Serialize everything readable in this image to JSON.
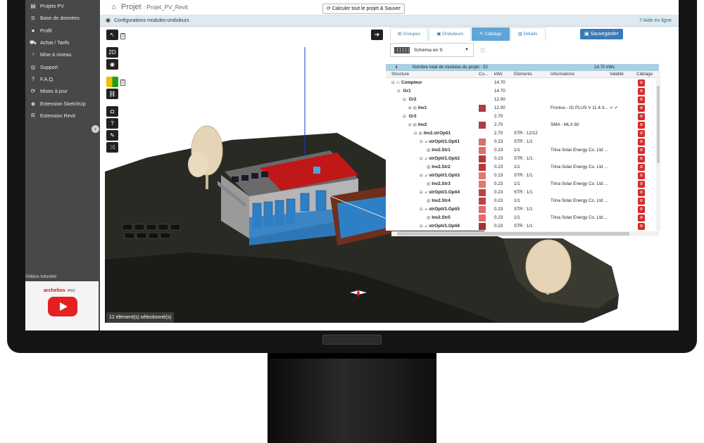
{
  "sidebar": {
    "items": [
      {
        "icon": "folder-icon",
        "glyph": "▤",
        "label": "Projets PV"
      },
      {
        "icon": "database-icon",
        "glyph": "≣",
        "label": "Base de données"
      },
      {
        "icon": "user-icon",
        "glyph": "●",
        "label": "Profil"
      },
      {
        "icon": "cart-icon",
        "glyph": "⛟",
        "label": "Achat / Tarifs"
      },
      {
        "icon": "upgrade-arrow-icon",
        "glyph": "↑",
        "label": "Mise à niveau"
      },
      {
        "icon": "support-icon",
        "glyph": "◎",
        "label": "Support"
      },
      {
        "icon": "question-icon",
        "glyph": "?",
        "label": "F.A.Q."
      },
      {
        "icon": "refresh-icon",
        "glyph": "⟳",
        "label": "Mises à jour"
      },
      {
        "icon": "sketchup-icon",
        "glyph": "◈",
        "label": "Extension SketchUp"
      },
      {
        "icon": "revit-icon",
        "glyph": "R",
        "label": "Extension Revit"
      }
    ],
    "tutorial_label": "Vidéos tutoriels",
    "tutorial_brand": "archelios",
    "tutorial_brand_suffix": "PRO"
  },
  "header": {
    "title": "Projet",
    "project_name": ": Projet_PV_Revit",
    "calc_button": "Calculer tout le projet & Sauver"
  },
  "subbar": {
    "title": "Configurations modules-onduleurs",
    "help": "Aide en ligne"
  },
  "viewport": {
    "tools_2d": "2D",
    "selection_status": "12 élément(s) sélectionné(s)"
  },
  "panel": {
    "tabs": [
      {
        "label": "Groupes",
        "glyph": "⊞"
      },
      {
        "label": "Onduleurs",
        "glyph": "▣"
      },
      {
        "label": "Câblage",
        "glyph": "✎"
      },
      {
        "label": "Détails",
        "glyph": "▥"
      }
    ],
    "active_tab": "Câblage",
    "save_button": "Sauvegarder",
    "schema_select": "Schéma en S",
    "summary_label": "Nombre total de modules du projet : 52",
    "summary_value": "14.70 kWc",
    "columns": {
      "structure": "Structure",
      "color": "Co...",
      "kwc": "kWc",
      "elements": "Eléments",
      "informations": "Informations",
      "validity": "Validité",
      "cabling": "Câblage"
    },
    "rows": [
      {
        "indent": 1,
        "pm": "⊟",
        "icon": "▭",
        "name": "Compteur",
        "bold": true,
        "color": "",
        "kwc": "14.70",
        "elements": "",
        "info": "",
        "valid": ""
      },
      {
        "indent": 2,
        "pm": "⊟",
        "icon": "",
        "name": "Gr1",
        "bold": true,
        "color": "",
        "kwc": "14.70",
        "elements": "",
        "info": "",
        "valid": ""
      },
      {
        "indent": 3,
        "pm": "⊟",
        "icon": "",
        "name": "Gr2",
        "bold": true,
        "color": "",
        "kwc": "12.00",
        "elements": "",
        "info": "",
        "valid": ""
      },
      {
        "indent": 4,
        "pm": "⊞",
        "icon": "▨",
        "name": "Inv1",
        "bold": true,
        "color": "#b23a3a",
        "kwc": "12.00",
        "elements": "",
        "info": "Fronius - IG PLUS V 11.4-3...",
        "valid": "✔ ✔"
      },
      {
        "indent": 3,
        "pm": "⊟",
        "icon": "",
        "name": "Gr3",
        "bold": true,
        "color": "",
        "kwc": "2.70",
        "elements": "",
        "info": "",
        "valid": ""
      },
      {
        "indent": 4,
        "pm": "⊟",
        "icon": "▨",
        "name": "Inv2",
        "bold": true,
        "color": "#b23a3a",
        "kwc": "2.70",
        "elements": "",
        "info": "SMA - MLX 60",
        "valid": ""
      },
      {
        "indent": 5,
        "pm": "⊟",
        "icon": "▥",
        "name": "Inv2.strOpti1",
        "bold": true,
        "color": "",
        "kwc": "2.70",
        "elements": "STR : 12/12",
        "info": "",
        "valid": ""
      },
      {
        "indent": 6,
        "pm": "⊟",
        "icon": "⊿",
        "name": "strOpti/1.Opti1",
        "bold": true,
        "color": "#e06c6c",
        "kwc": "0.23",
        "elements": "STR : 1/1",
        "info": "",
        "valid": ""
      },
      {
        "indent": 7,
        "pm": "",
        "icon": "▥",
        "name": "Inv2.Str1",
        "bold": true,
        "color": "#e06c6c",
        "kwc": "0.23",
        "elements": "1/1",
        "info": "Trina Solar Energy Co. Ltd ...",
        "valid": ""
      },
      {
        "indent": 6,
        "pm": "⊟",
        "icon": "⊿",
        "name": "strOpti/1.Opti2",
        "bold": true,
        "color": "#b23a3a",
        "kwc": "0.23",
        "elements": "STR : 1/1",
        "info": "",
        "valid": ""
      },
      {
        "indent": 7,
        "pm": "",
        "icon": "▥",
        "name": "Inv2.Str2",
        "bold": true,
        "color": "#b23a3a",
        "kwc": "0.23",
        "elements": "1/1",
        "info": "Trina Solar Energy Co. Ltd ...",
        "valid": ""
      },
      {
        "indent": 6,
        "pm": "⊟",
        "icon": "⊿",
        "name": "strOpti/1.Opti3",
        "bold": true,
        "color": "#e07a6a",
        "kwc": "0.23",
        "elements": "STR : 1/1",
        "info": "",
        "valid": ""
      },
      {
        "indent": 7,
        "pm": "",
        "icon": "▥",
        "name": "Inv2.Str3",
        "bold": true,
        "color": "#e07a6a",
        "kwc": "0.23",
        "elements": "1/1",
        "info": "Trina Solar Energy Co. Ltd ...",
        "valid": ""
      },
      {
        "indent": 6,
        "pm": "⊟",
        "icon": "⊿",
        "name": "strOpti/1.Opti4",
        "bold": true,
        "color": "#b84646",
        "kwc": "0.23",
        "elements": "STR : 1/1",
        "info": "",
        "valid": ""
      },
      {
        "indent": 7,
        "pm": "",
        "icon": "▥",
        "name": "Inv2.Str4",
        "bold": true,
        "color": "#b84646",
        "kwc": "0.23",
        "elements": "1/1",
        "info": "Trina Solar Energy Co. Ltd ...",
        "valid": ""
      },
      {
        "indent": 6,
        "pm": "⊟",
        "icon": "⊿",
        "name": "strOpti/1.Opti5",
        "bold": true,
        "color": "#e26a6a",
        "kwc": "0.23",
        "elements": "STR : 1/1",
        "info": "",
        "valid": ""
      },
      {
        "indent": 7,
        "pm": "",
        "icon": "▥",
        "name": "Inv2.Str5",
        "bold": true,
        "color": "#e26a6a",
        "kwc": "0.23",
        "elements": "1/1",
        "info": "Trina Solar Energy Co. Ltd ...",
        "valid": ""
      },
      {
        "indent": 6,
        "pm": "⊟",
        "icon": "⊿",
        "name": "strOpti/1.Opti6",
        "bold": true,
        "color": "#a83030",
        "kwc": "0.23",
        "elements": "STR : 1/1",
        "info": "",
        "valid": ""
      }
    ]
  },
  "colors": {
    "sidebar_bg": "#484848",
    "accent": "#5fa5d6",
    "save_button": "#3a7ab8",
    "cabling_icon": "#d52b2b"
  }
}
